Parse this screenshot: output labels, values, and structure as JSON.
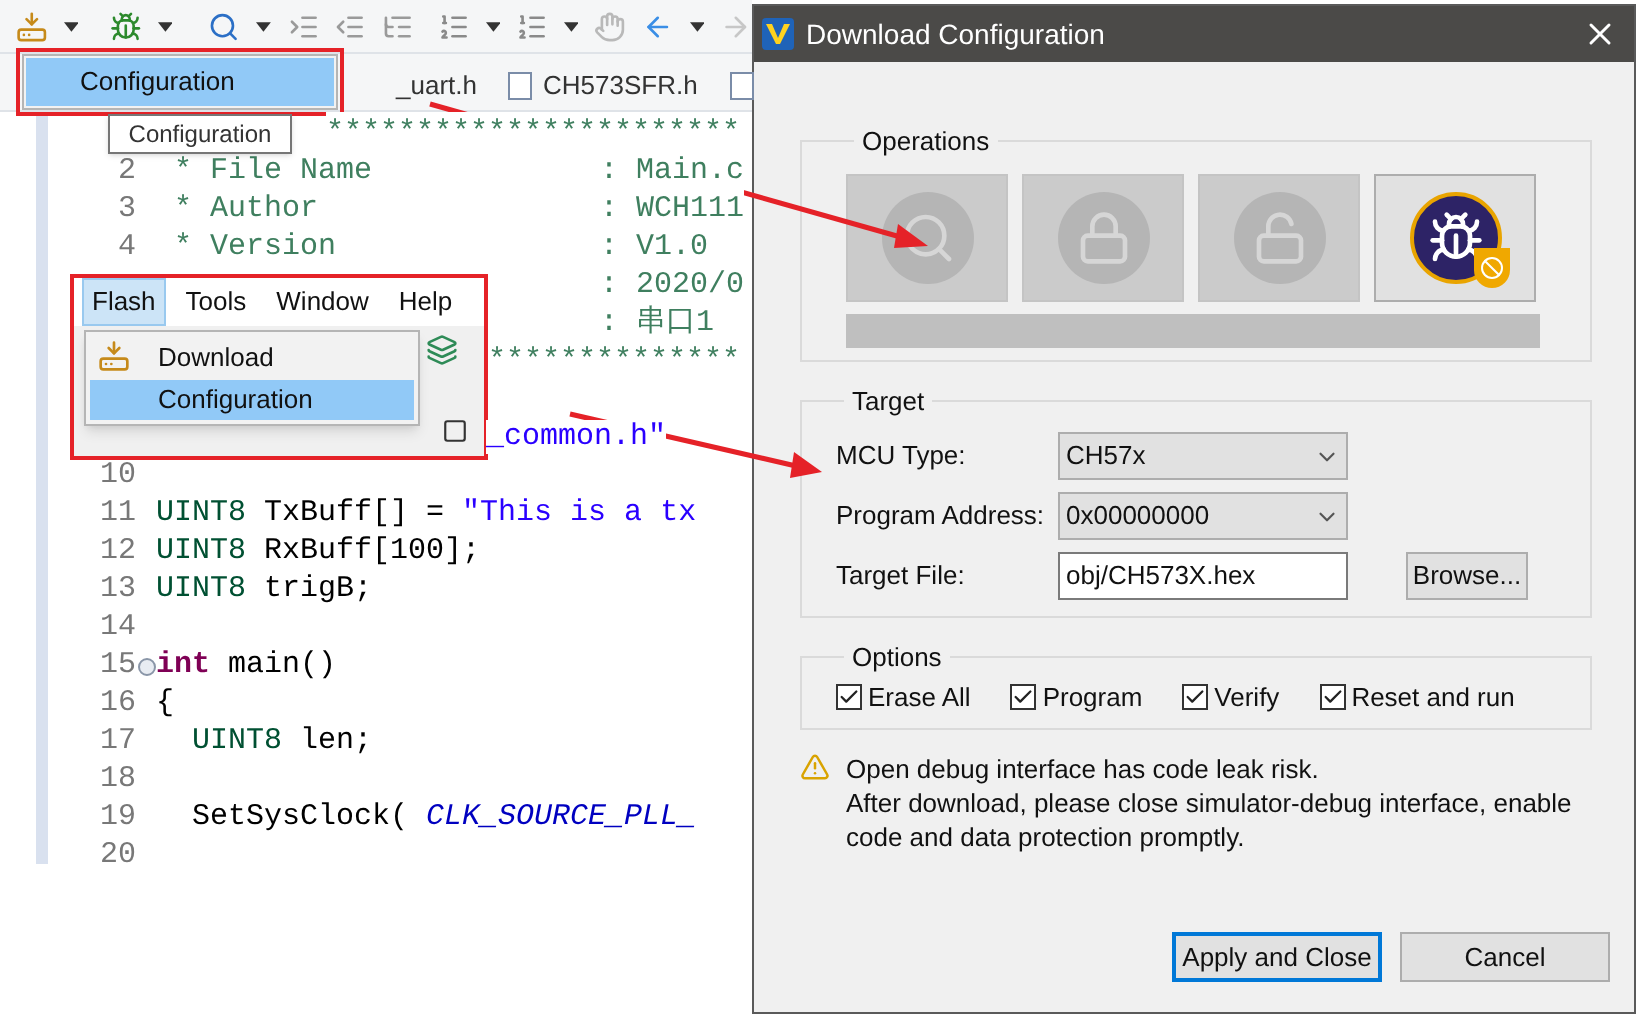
{
  "toolbar_popup": {
    "items": [
      {
        "label": "Configuration",
        "selected": true
      }
    ]
  },
  "tooltip": "Configuration",
  "tabs": [
    {
      "label": "_uart.h"
    },
    {
      "label": "CH573SFR.h"
    }
  ],
  "editor": {
    "lines": [
      {
        "kind": "banner",
        "segments": [
          {
            "text": "***********************",
            "kind": "comment"
          }
        ]
      },
      {
        "kind": "header",
        "number": "2",
        "segments": [
          {
            "text": " * File Name",
            "kind": "comment"
          }
        ],
        "value": ": Main.c"
      },
      {
        "kind": "header",
        "number": "3",
        "segments": [
          {
            "text": " * Author",
            "kind": "comment"
          }
        ],
        "value": ": WCH111"
      },
      {
        "kind": "header",
        "number": "4",
        "segments": [
          {
            "text": " * Version",
            "kind": "comment"
          }
        ],
        "value": ": V1.0"
      },
      {
        "kind": "value",
        "value": ": 2020/0"
      },
      {
        "kind": "value",
        "value": ": 串口1"
      },
      {
        "kind": "banner",
        "segments": [
          {
            "text": "**************",
            "kind": "comment"
          }
        ]
      },
      {
        "kind": "code"
      },
      {
        "kind": "fragment",
        "segments": [
          {
            "text": "_common.h\"",
            "kind": "string"
          }
        ]
      },
      {
        "kind": "code",
        "number": "10"
      },
      {
        "kind": "code",
        "number": "11",
        "segments": [
          {
            "text": "UINT8",
            "kind": "type"
          },
          {
            "text": " TxBuff[] = ",
            "kind": "plain"
          },
          {
            "text": "\"This is a tx",
            "kind": "string"
          }
        ]
      },
      {
        "kind": "code",
        "number": "12",
        "segments": [
          {
            "text": "UINT8",
            "kind": "type"
          },
          {
            "text": " RxBuff[100];",
            "kind": "plain"
          }
        ]
      },
      {
        "kind": "code",
        "number": "13",
        "segments": [
          {
            "text": "UINT8",
            "kind": "type"
          },
          {
            "text": " trigB;",
            "kind": "plain"
          }
        ]
      },
      {
        "kind": "code",
        "number": "14"
      },
      {
        "kind": "code",
        "number": "15",
        "folded": false,
        "segments": [
          {
            "text": "int",
            "kind": "keyword"
          },
          {
            "text": " main()",
            "kind": "plain"
          }
        ]
      },
      {
        "kind": "code",
        "number": "16",
        "segments": [
          {
            "text": "{",
            "kind": "plain"
          }
        ]
      },
      {
        "kind": "code",
        "number": "17",
        "segments": [
          {
            "text": "  UINT8",
            "kind": "type"
          },
          {
            "text": " len;",
            "kind": "plain"
          }
        ]
      },
      {
        "kind": "code",
        "number": "18"
      },
      {
        "kind": "code",
        "number": "19",
        "segments": [
          {
            "text": "  SetSysClock( ",
            "kind": "plain"
          },
          {
            "text": "CLK_SOURCE_PLL_",
            "kind": "macro"
          }
        ]
      },
      {
        "kind": "code",
        "number": "20"
      }
    ]
  },
  "flash_menu": {
    "menubar": [
      {
        "label": "Flash",
        "selected": true
      },
      {
        "label": "Tools",
        "selected": false
      },
      {
        "label": "Window",
        "selected": false
      },
      {
        "label": "Help",
        "selected": false
      }
    ],
    "items": [
      {
        "label": "Download",
        "selected": false,
        "kind": "icon"
      },
      {
        "label": "Configuration",
        "selected": true,
        "kind": "plain"
      }
    ]
  },
  "dialog": {
    "title": "Download Configuration",
    "operations": {
      "title": "Operations",
      "buttons": [
        {
          "kind": "read",
          "disabled": true
        },
        {
          "kind": "lock",
          "disabled": true
        },
        {
          "kind": "unlock",
          "disabled": true
        },
        {
          "kind": "debug",
          "disabled": false
        }
      ],
      "progress": {
        "level": 0
      }
    },
    "target": {
      "title": "Target",
      "fields": [
        {
          "label": "MCU Type:",
          "value": "CH57x",
          "kind": "select"
        },
        {
          "label": "Program Address:",
          "value": "0x00000000",
          "kind": "select"
        },
        {
          "label": "Target File:",
          "value": "obj/CH573X.hex",
          "kind": "text"
        }
      ],
      "browse": "Browse..."
    },
    "options": {
      "title": "Options",
      "checks": [
        {
          "label": "Erase All",
          "checked": true
        },
        {
          "label": "Program",
          "checked": true
        },
        {
          "label": "Verify",
          "checked": true
        },
        {
          "label": "Reset and run",
          "checked": true
        }
      ]
    },
    "warning": [
      "Open debug interface has code leak risk.",
      "After download, please close simulator-debug interface, enable code and data protection promptly."
    ],
    "buttons": [
      {
        "label": "Apply and Close",
        "default": true
      },
      {
        "label": "Cancel",
        "default": false
      }
    ]
  }
}
